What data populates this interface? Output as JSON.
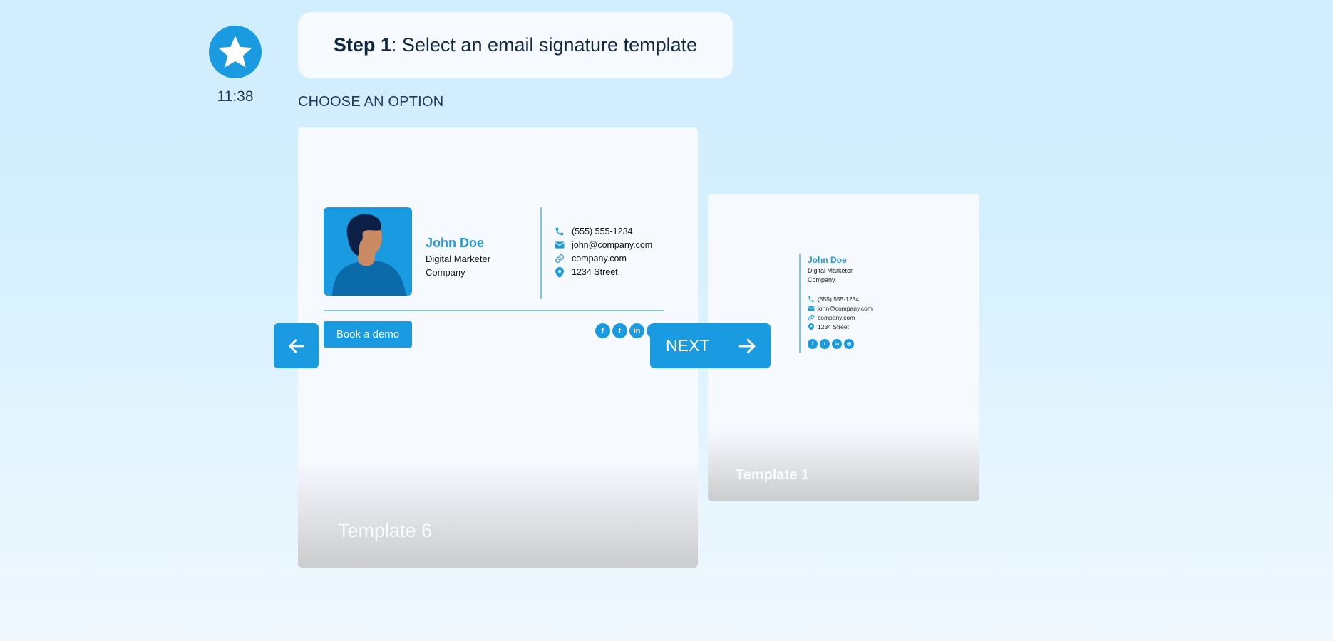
{
  "sender": {
    "icon": "star-icon",
    "time": "11:38"
  },
  "message": {
    "step_label": "Step 1",
    "text": ": Select an email signature template"
  },
  "prompt": "CHOOSE AN OPTION",
  "colors": {
    "accent": "#1a9ae0",
    "name_blue": "#2a98d5",
    "divider": "#7fc3e6"
  },
  "templates": [
    {
      "label": "Template 6",
      "signature": {
        "name": "John Doe",
        "title": "Digital Marketer",
        "company": "Company",
        "contacts": [
          {
            "icon": "phone-icon",
            "text": "(555) 555-1234"
          },
          {
            "icon": "email-icon",
            "text": "john@company.com"
          },
          {
            "icon": "link-icon",
            "text": "company.com"
          },
          {
            "icon": "location-icon",
            "text": "1234 Street"
          }
        ],
        "cta": "Book a demo",
        "socials": [
          "facebook",
          "twitter",
          "linkedin",
          "instagram"
        ]
      }
    },
    {
      "label": "Template 1",
      "signature": {
        "name": "John Doe",
        "title": "Digital Marketer",
        "company": "Company",
        "contacts": [
          {
            "icon": "phone-icon",
            "text": "(555) 555-1234"
          },
          {
            "icon": "email-icon",
            "text": "john@company.com"
          },
          {
            "icon": "link-icon",
            "text": "company.com"
          },
          {
            "icon": "location-icon",
            "text": "1234 Street"
          }
        ],
        "socials": [
          "facebook",
          "twitter",
          "linkedin",
          "instagram"
        ]
      }
    }
  ],
  "nav": {
    "prev_icon": "arrow-left-icon",
    "next_label": "NEXT",
    "next_icon": "arrow-right-icon"
  }
}
